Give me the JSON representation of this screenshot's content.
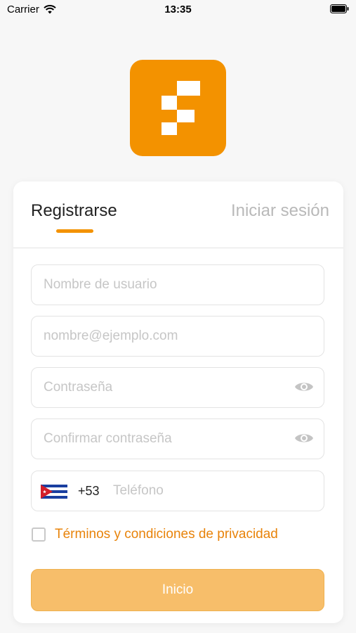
{
  "status_bar": {
    "carrier": "Carrier",
    "time": "13:35",
    "wifi_icon": "wifi-icon",
    "battery_icon": "battery-icon"
  },
  "app": {
    "logo_icon": "app-logo-icon",
    "brand_color": "#f39200"
  },
  "tabs": [
    {
      "label": "Registrarse",
      "active": true
    },
    {
      "label": "Iniciar sesión",
      "active": false
    }
  ],
  "form": {
    "username": {
      "value": "",
      "placeholder": "Nombre de usuario"
    },
    "email": {
      "value": "",
      "placeholder": "nombre@ejemplo.com"
    },
    "password": {
      "value": "",
      "placeholder": "Contraseña",
      "toggle_icon": "eye-icon"
    },
    "confirm_password": {
      "value": "",
      "placeholder": "Confirmar contraseña",
      "toggle_icon": "eye-icon"
    },
    "phone": {
      "flag_icon": "cuba-flag-icon",
      "dial_code": "+53",
      "value": "",
      "placeholder": "Teléfono"
    },
    "terms": {
      "label": "Términos y condiciones de privacidad",
      "checked": false,
      "color": "#e8830a"
    },
    "submit_label": "Inicio"
  }
}
